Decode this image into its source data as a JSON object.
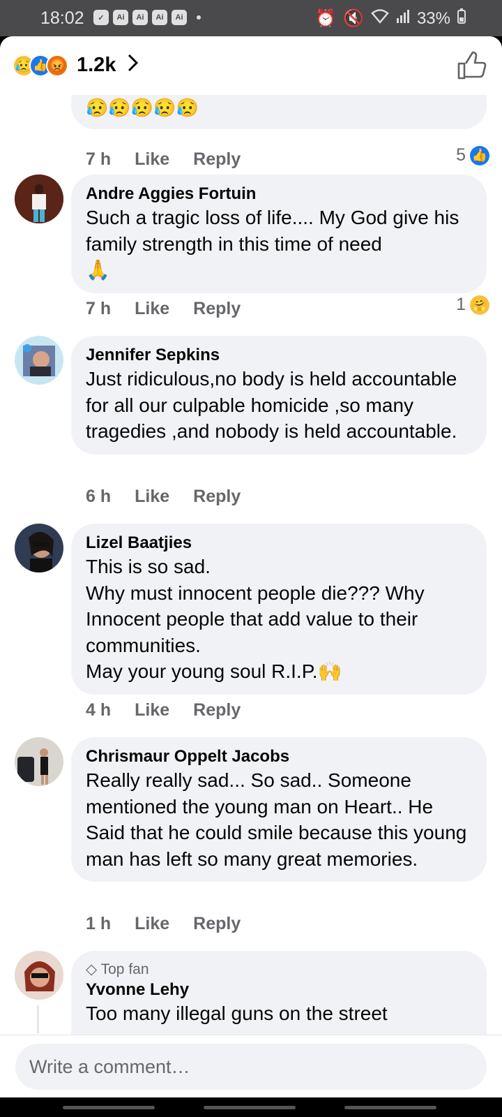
{
  "status_bar": {
    "time": "18:02",
    "battery": "33%",
    "left_icons": [
      "Ai",
      "Ai",
      "Ai",
      "Ai"
    ]
  },
  "header": {
    "reaction_count": "1.2k",
    "reactions": [
      "sad",
      "like",
      "angry"
    ]
  },
  "comments": [
    {
      "id": "c0",
      "partial_text": "😥😥😥😥😥",
      "time": "7 h",
      "like_label": "Like",
      "reply_label": "Reply",
      "reaction_count": "5",
      "reaction": "like"
    },
    {
      "id": "c1",
      "author": "Andre Aggies Fortuin",
      "text": "Such a tragic loss of life.... My God give his family strength in this time of need\n🙏",
      "time": "7 h",
      "like_label": "Like",
      "reply_label": "Reply",
      "reaction_count": "1",
      "reaction": "care"
    },
    {
      "id": "c2",
      "author": "Jennifer Sepkins",
      "text": "Just ridiculous,no body is held accountable for all our culpable homicide ,so many tragedies ,and nobody is held accountable.",
      "time": "6 h",
      "like_label": "Like",
      "reply_label": "Reply"
    },
    {
      "id": "c3",
      "author": "Lizel Baatjies",
      "text": "This is so sad.\nWhy must innocent people die??? Why Innocent people that add value to their communities.\nMay your young soul R.I.P.🙌",
      "time": "4 h",
      "like_label": "Like",
      "reply_label": "Reply"
    },
    {
      "id": "c4",
      "author": "Chrismaur Oppelt Jacobs",
      "text": "Really really sad... So sad.. Someone mentioned the young man on Heart.. He Said that he could smile because this young man has left so many great memories.",
      "time": "1 h",
      "like_label": "Like",
      "reply_label": "Reply"
    },
    {
      "id": "c5",
      "badge": "Top fan",
      "author": "Yvonne Lehy",
      "text": "Too many illegal guns on the street"
    }
  ],
  "composer": {
    "placeholder": "Write a comment…"
  }
}
